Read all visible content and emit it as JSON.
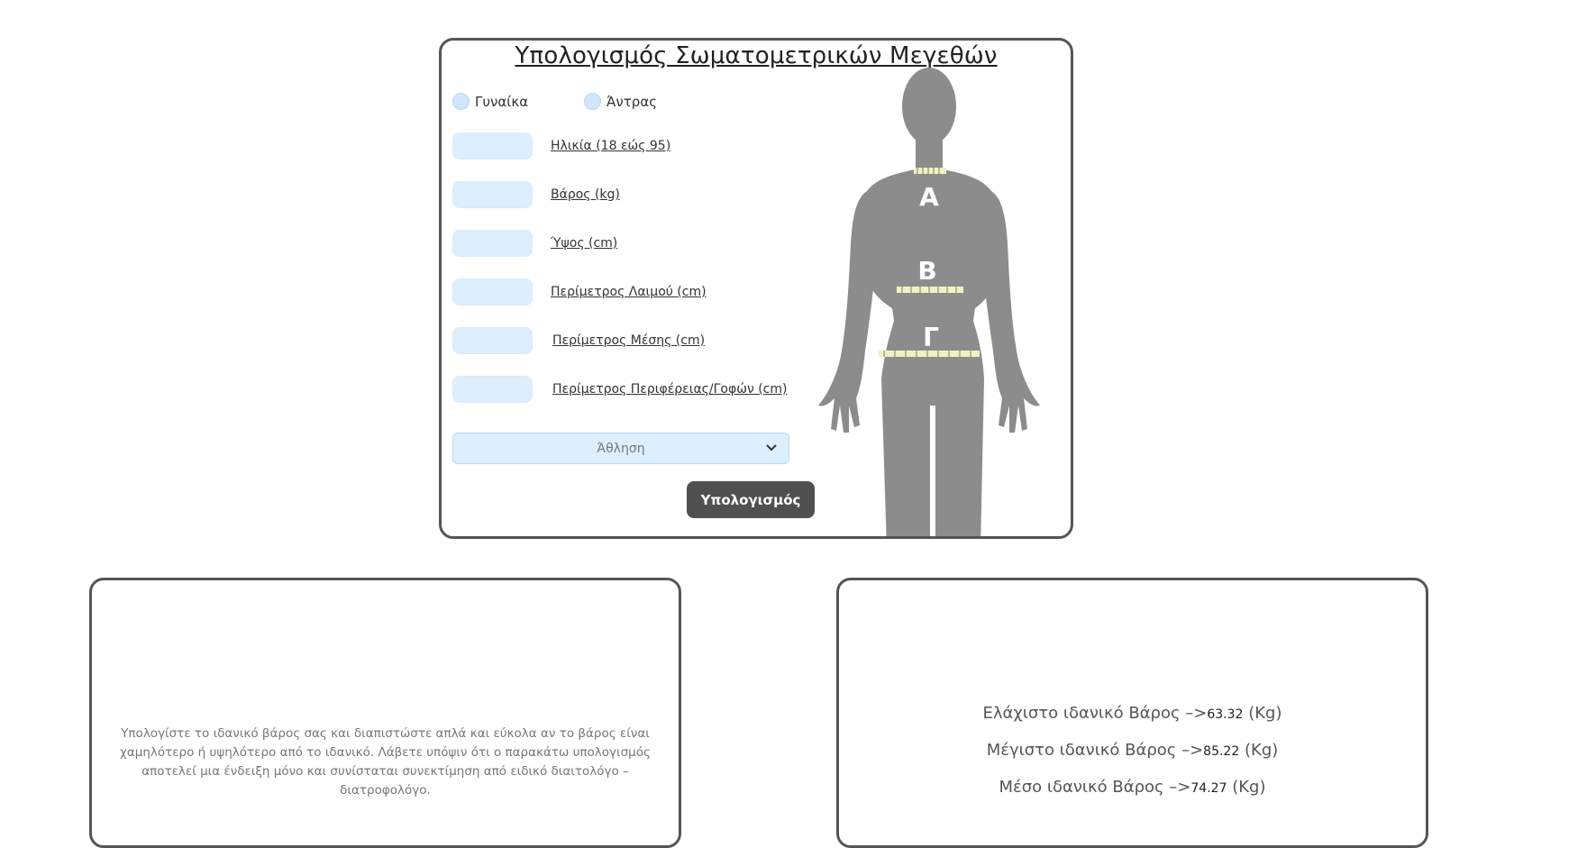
{
  "calculator": {
    "title": "Υπολογισμός Σωματομετρικών Μεγεθών",
    "gender": {
      "female": "Γυναίκα",
      "male": "Άντρας"
    },
    "fields": [
      {
        "label": "Ηλικία (18 εώς 95)",
        "value": "",
        "placeholder": ""
      },
      {
        "label": "Βάρος (kg)",
        "value": "",
        "placeholder": ""
      },
      {
        "label": "Ύψος (cm)",
        "value": "",
        "placeholder": ""
      },
      {
        "label": "Περίμετρος Λαιμού (cm)",
        "value": "",
        "placeholder": ""
      },
      {
        "label": "Περίμετρος Μέσης (cm)",
        "value": "",
        "placeholder": ""
      },
      {
        "label": "Περίμετρος Περιφέρειας/Γοφών (cm)",
        "value": "",
        "placeholder": ""
      }
    ],
    "activity_select": {
      "selected": "Άθληση"
    },
    "submit_label": "Υπολογισμός",
    "figure": {
      "markers": {
        "neck": "A",
        "waist": "B",
        "hips": "Γ"
      },
      "body_color": "#8c8c8c",
      "tape_color": "#f3f1c3"
    }
  },
  "info": {
    "text": "Υπολογίστε το ιδανικό βάρος σας και διαπιστώστε απλά και εύκολα αν το βάρος είναι χαμηλότερο ή υψηλότερο από το ιδανικό. Λάβετε υπόψιν ότι ο παρακάτω υπολογισμός αποτελεί μια ένδειξη μόνο και συνίσταται συνεκτίμηση από ειδικό διαιτολόγο – διατροφολόγο."
  },
  "results": {
    "min": {
      "label": "Ελάχιστο ιδανικό Βάρος –>",
      "value": "63.32",
      "unit": "(Kg)"
    },
    "max": {
      "label": "Μέγιστο ιδανικό Βάρος –>",
      "value": "85.22",
      "unit": "(Kg)"
    },
    "avg": {
      "label": "Μέσο ιδανικό Βάρος –>",
      "value": "74.27",
      "unit": "(Kg)"
    }
  }
}
